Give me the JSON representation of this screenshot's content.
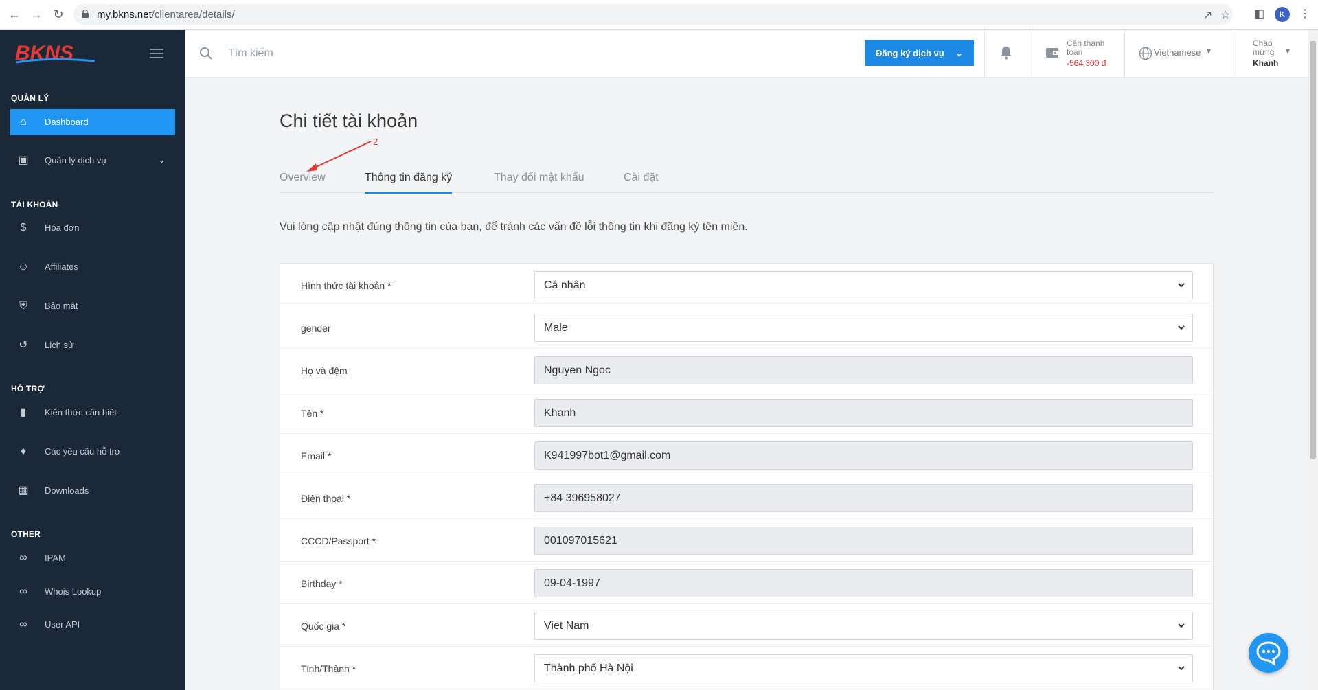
{
  "browser": {
    "url_host": "my.bkns.net",
    "url_path": "/clientarea/details/",
    "profile_initial": "K"
  },
  "brand": {
    "logo_text": "BKNS",
    "accent": "#2196f3",
    "sidebar_bg": "#1b2838"
  },
  "sidebar": {
    "sections": [
      {
        "title": "QUẢN LÝ"
      },
      {
        "title": "TÀI KHOẢN"
      },
      {
        "title": "HỖ TRỢ"
      },
      {
        "title": "OTHER"
      }
    ],
    "items": [
      {
        "label": "Dashboard",
        "icon": "home-icon",
        "active": true
      },
      {
        "label": "Quản lý dịch vụ",
        "icon": "contact-card-icon"
      },
      {
        "label": "Hóa đơn",
        "icon": "dollar-icon"
      },
      {
        "label": "Affiliates",
        "icon": "users-icon"
      },
      {
        "label": "Bảo mật",
        "icon": "shield-icon"
      },
      {
        "label": "Lịch sử",
        "icon": "history-icon"
      },
      {
        "label": "Kiến thức cần biết",
        "icon": "book-icon"
      },
      {
        "label": "Các yêu cầu hỗ trợ",
        "icon": "ticket-icon"
      },
      {
        "label": "Downloads",
        "icon": "save-icon"
      },
      {
        "label": "IPAM",
        "icon": "link-icon"
      },
      {
        "label": "Whois Lookup",
        "icon": "link-icon"
      },
      {
        "label": "User API",
        "icon": "link-icon"
      }
    ]
  },
  "topbar": {
    "search_placeholder": "Tìm kiếm",
    "register_button": "Đăng ký dịch vụ",
    "payment_label": "Cần thanh toán",
    "payment_amount": "-564,300 đ",
    "language": "Vietnamese",
    "greeting": "Chào mừng",
    "user_name": "Khanh"
  },
  "page": {
    "title": "Chi tiết tài khoản",
    "annotation_number": "2",
    "tabs": [
      {
        "label": "Overview",
        "active": false
      },
      {
        "label": "Thông tin đăng ký",
        "active": true
      },
      {
        "label": "Thay đổi mật khẩu",
        "active": false
      },
      {
        "label": "Cài đặt",
        "active": false
      }
    ],
    "intro": "Vui lòng cập nhật đúng thông tin của bạn, để tránh các vấn đề lỗi thông tin khi đăng ký tên miền."
  },
  "form": {
    "rows": [
      {
        "label": "Hình thức tài khoản *",
        "value": "Cá nhân",
        "type": "select"
      },
      {
        "label": "gender",
        "value": "Male",
        "type": "select"
      },
      {
        "label": "Họ và đệm",
        "value": "Nguyen Ngoc",
        "type": "readonly"
      },
      {
        "label": "Tên *",
        "value": "Khanh",
        "type": "readonly"
      },
      {
        "label": "Email *",
        "value": "K941997bot1@gmail.com",
        "type": "readonly"
      },
      {
        "label": "Điện thoại *",
        "value": "+84 396958027",
        "type": "readonly"
      },
      {
        "label": "CCCD/Passport *",
        "value": "001097015621",
        "type": "readonly"
      },
      {
        "label": "Birthday *",
        "value": "09-04-1997",
        "type": "readonly"
      },
      {
        "label": "Quốc gia *",
        "value": "Viet Nam",
        "type": "select"
      },
      {
        "label": "Tỉnh/Thành *",
        "value": "Thành phố Hà Nội",
        "type": "select"
      }
    ]
  }
}
